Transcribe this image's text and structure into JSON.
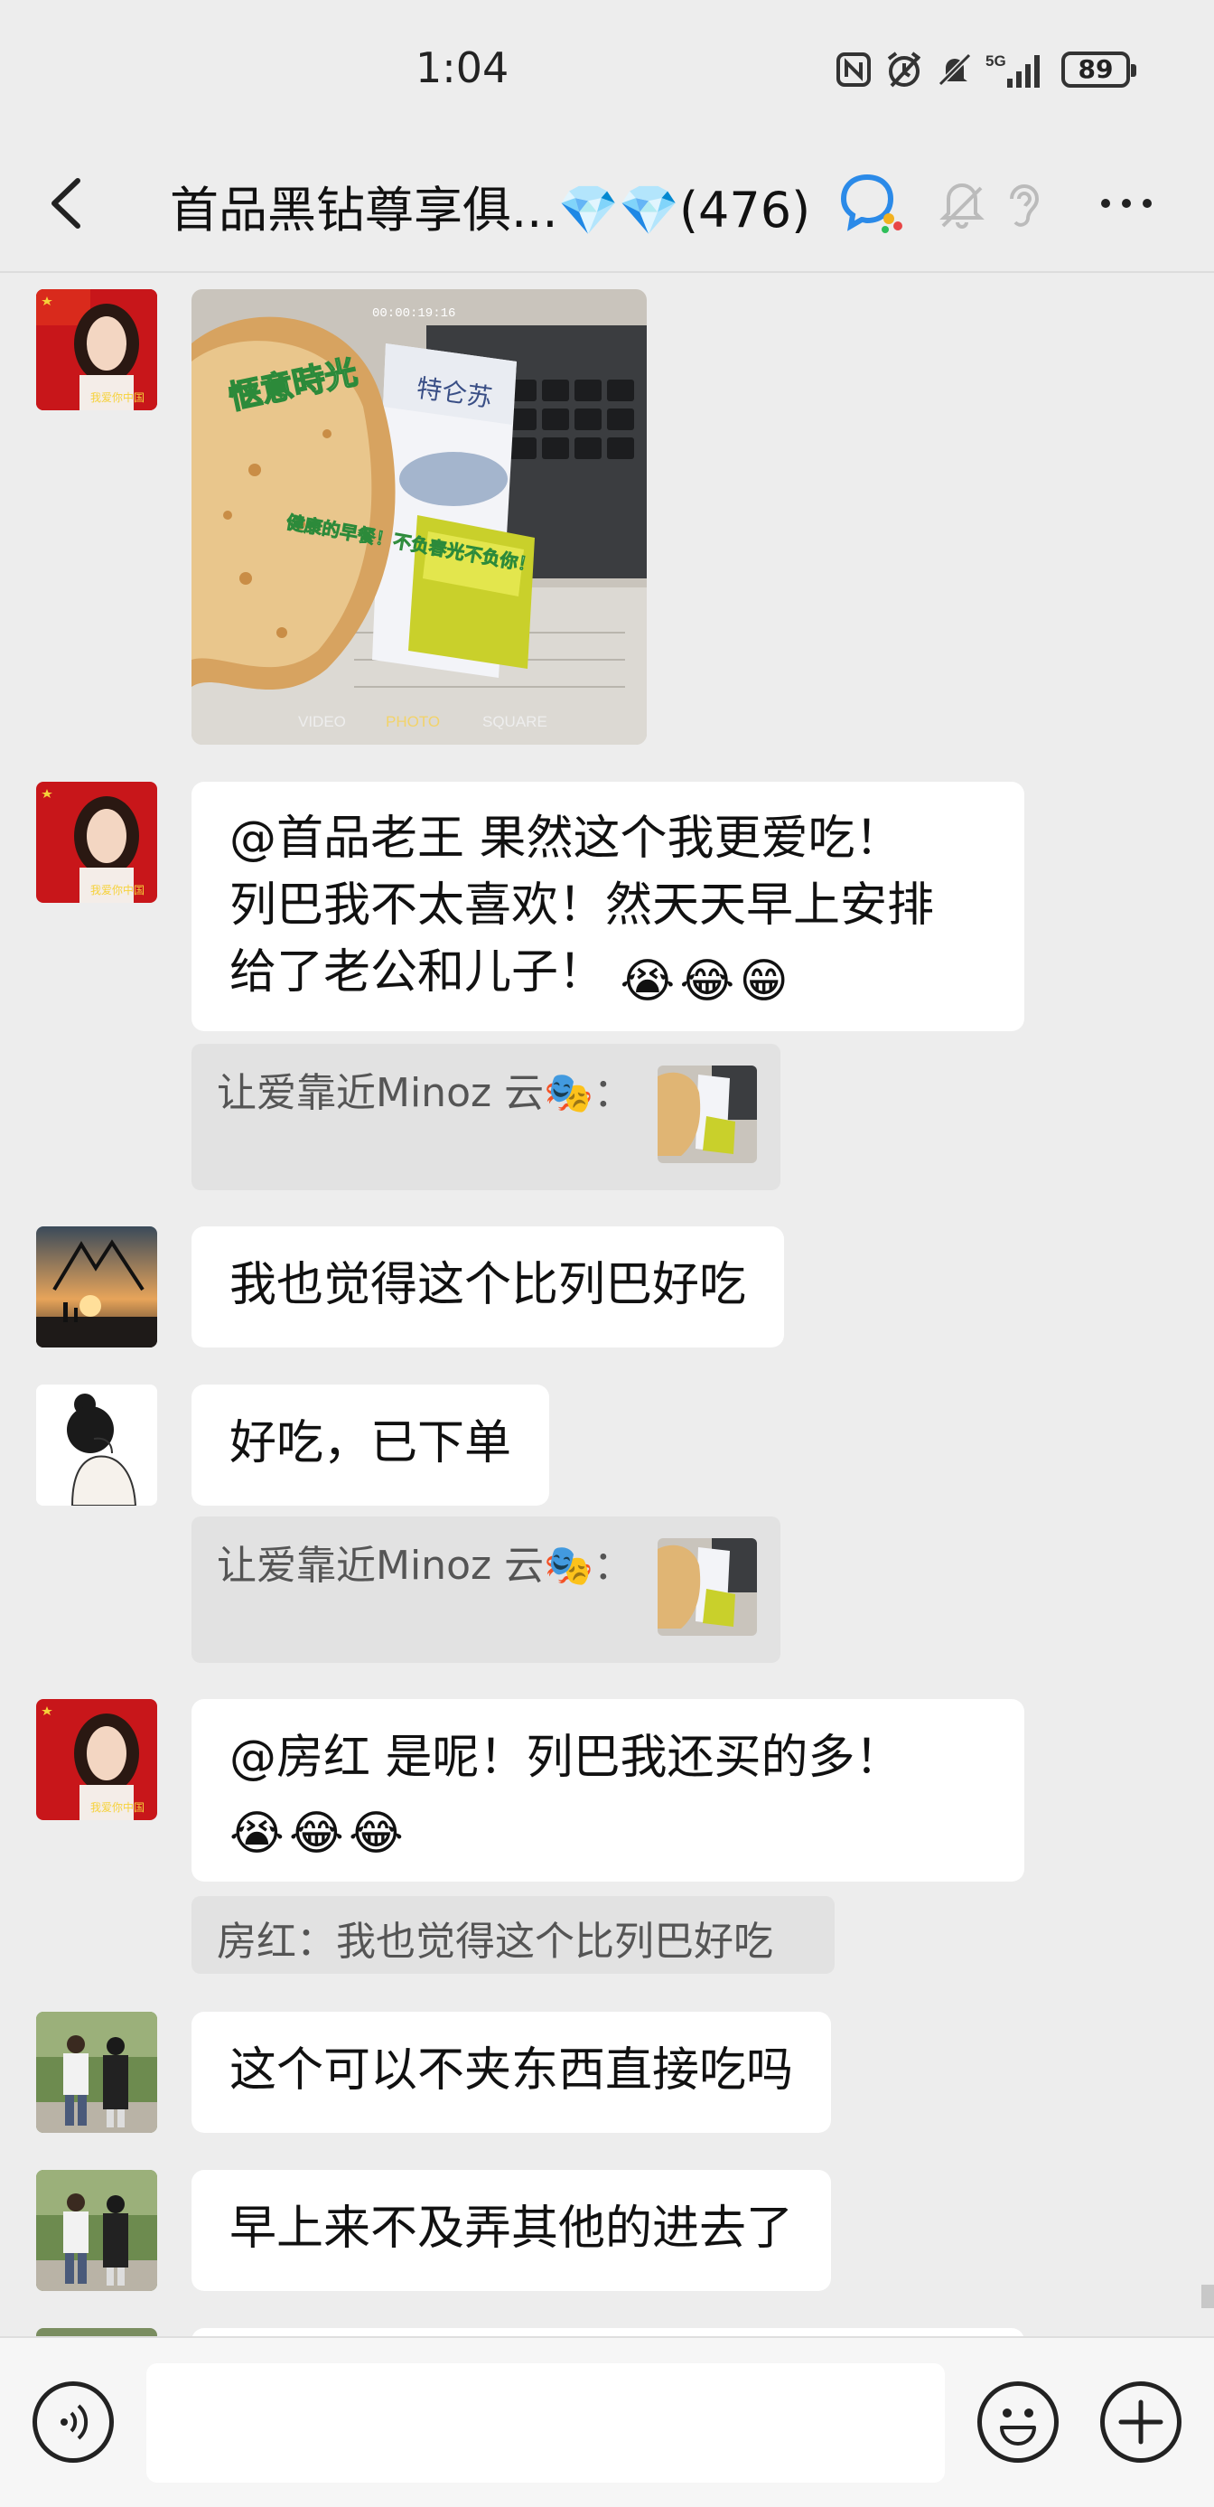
{
  "status_bar": {
    "time": "1:04",
    "network": "5G",
    "battery": "89",
    "icons": [
      "nfc-icon",
      "alarm-icon",
      "mute-icon",
      "signal-icon",
      "battery-icon"
    ]
  },
  "header": {
    "title": "首品黑钻尊享俱...",
    "gems": "💎💎",
    "count": "(476)",
    "icons": [
      "back-icon",
      "chat-search-icon",
      "mute-bell-icon",
      "ear-icon",
      "more-icon"
    ]
  },
  "messages": [
    {
      "type": "image",
      "photo_text": {
        "top": "00:00:19:16",
        "title": "惬意時光",
        "brand": "特仑苏",
        "caption": "健康的早餐！不负春光不负你！",
        "modes": [
          "VIDEO",
          "PHOTO",
          "SQUARE"
        ]
      }
    },
    {
      "type": "text",
      "lines": [
        "@首品老王  果然这个我更爱吃！",
        "列巴我不太喜欢！然天天早上安排",
        "给了老公和儿子！"
      ],
      "emojis": [
        "😭",
        "😂",
        "😁"
      ]
    },
    {
      "type": "quote",
      "text": "让爱靠近Minoz 云🎭："
    },
    {
      "type": "text",
      "lines": [
        "我也觉得这个比列巴好吃"
      ]
    },
    {
      "type": "text",
      "lines": [
        "好吃，已下单"
      ]
    },
    {
      "type": "quote",
      "text": "让爱靠近Minoz 云🎭："
    },
    {
      "type": "text",
      "lines": [
        "@房红  是呢！列巴我还买的多！"
      ],
      "emojis": [
        "😭",
        "😂",
        "😂"
      ]
    },
    {
      "type": "quote",
      "text": "房红：我也觉得这个比列巴好吃"
    },
    {
      "type": "text",
      "lines": [
        "这个可以不夹东西直接吃吗"
      ]
    },
    {
      "type": "text",
      "lines": [
        "早上来不及弄其他的进去了"
      ]
    }
  ],
  "input": {
    "voice_icon": "voice-icon",
    "emoji_icon": "emoji-icon",
    "plus_icon": "plus-icon",
    "value": ""
  }
}
